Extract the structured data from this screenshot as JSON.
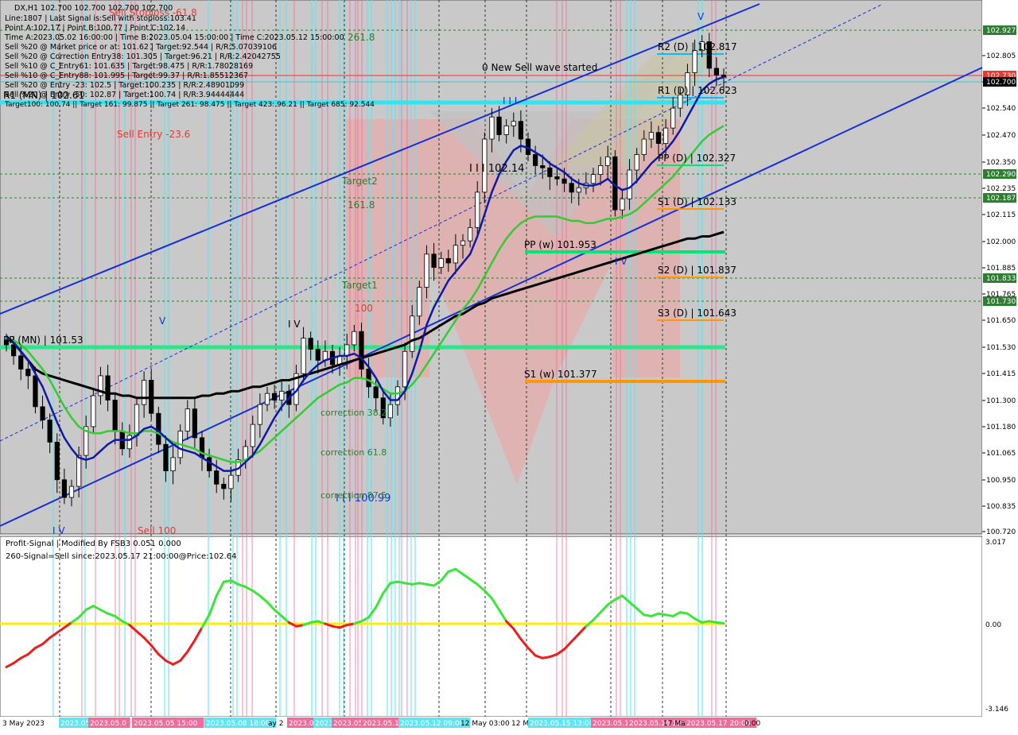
{
  "window": {
    "symbol_line": "DX,H1  102.700 102.700 102.700 102.700",
    "info_lines": [
      "Line:1807 | Last Signal is:Sell with stoploss:103.41",
      "Point A:102.17 | Point B:100.77 | Point C:102.14",
      "Time A:2023.05.02 16:00:00 | Time B:2023.05.04 15:00:00 | Time C:2023.05.12 15:00:00",
      "Sell %20 @ Market price or at: 101.62 | Target:92.544 | R/R:5.07039106",
      "Sell %20 @ Correction Entry38: 101.305 | Target:96.21 | R/R:2.42042755",
      "Sell %10 @ C_Entry61: 101.635 | Target:98.475 | R/R:1.78028169",
      "Sell %10 @ C_Entry88: 101.995 | Target:99.37 | R/R:1.85512367",
      "Sell %20 @ Entry -23: 102.5 | Target:100.235 | R/R:2.48901099",
      "Sell %20 @ Entry -50: 102.87 | Target:100.74 | R/R:3.94444444"
    ],
    "targets_line": "Target100: 100.74 || Target 161: 99.875 || Target 261: 98.475 || Target 423: 96.21 || Target 685: 92.544"
  },
  "annotations": {
    "sell_stoploss": "Sell Stoploss -61.8",
    "sell_entry": "Sell Entry -23.6",
    "sell_100": "Sell 100",
    "target_261": "261.8",
    "target2": "Target2",
    "target_161": "161.8",
    "target1": "Target1",
    "t100": "100",
    "new_wave": "0 New Sell wave started",
    "wave_label_c": "I I I 102.14",
    "wave_label_b": "I I I 100.99",
    "corr_382": "correction 38.2",
    "corr_618": "correction 61.8",
    "corr_875": "correction 87.5",
    "r1_mn": "R1 (MN) | 102.61",
    "pp_mn": "PP (MN) | 101.53",
    "roman_3": "I I I",
    "roman_4": "I V",
    "roman_iv2": "I V",
    "roman_v": "V",
    "roman_v2": "V",
    "roman_iv_top": "I V",
    "roman_v_bot": "I V"
  },
  "pivots": [
    {
      "label": "R2 (D) | 102.817",
      "color": "#00c0ff"
    },
    {
      "label": "R1 (D) | 102.623",
      "color": "#00c0ff"
    },
    {
      "label": "PP (D) | 102.327",
      "color": "#00e676"
    },
    {
      "label": "S1 (D) | 102.133",
      "color": "#ff9800"
    },
    {
      "label": "PP (w)    101.953",
      "color": "#00e676"
    },
    {
      "label": "S2 (D) | 101.837",
      "color": "#ff9800"
    },
    {
      "label": "S3 (D) | 101.643",
      "color": "#ff9800"
    },
    {
      "label": "S1 (w)    101.377",
      "color": "#ff9800"
    }
  ],
  "price_axis": {
    "ticks": [
      "102.805",
      "102.670",
      "102.540",
      "102.470",
      "102.350",
      "102.235",
      "102.115",
      "102.000",
      "101.885",
      "101.765",
      "101.650",
      "101.530",
      "101.415",
      "101.300",
      "101.180",
      "101.065",
      "100.950",
      "100.835",
      "100.720"
    ],
    "marks": [
      {
        "label": "102.927",
        "color": "#2e7d32"
      },
      {
        "label": "102.730",
        "color": "#e53935"
      },
      {
        "label": "102.700",
        "color": "#000000"
      },
      {
        "label": "102.290",
        "color": "#2e7d32"
      },
      {
        "label": "102.187",
        "color": "#2e7d32"
      },
      {
        "label": "101.833",
        "color": "#2e7d32"
      },
      {
        "label": "101.730",
        "color": "#2e7d32"
      }
    ]
  },
  "indicator": {
    "title": "Profit-Signal | Modified By FSB3 0.051 0.000",
    "signal_text": "260-Signal=Sell since:2023.05.17 21:00:00@Price:102.64",
    "axis_top": "3.017",
    "axis_zero": "0.00",
    "axis_bottom": "-3.146"
  },
  "time_axis": {
    "labels": [
      "3 May 2023",
      "2023.05.04",
      "2023.05.0",
      "2023.05.05 15:00",
      "2023.05.08 18:00",
      "ay 2",
      "2023.05.10",
      "2023.05",
      "2023.05.11",
      "2023.05.11 2",
      "2023.05.12 09:00",
      "12 May 03:00",
      "12 M",
      "2023.05.15 13:00",
      "2023.05.16",
      "2023.05.16 19:00",
      "17 Ma",
      "2023.05.17 20:00",
      "0:00"
    ]
  },
  "chart_data": {
    "type": "candlestick",
    "symbol": "DX",
    "timeframe": "H1",
    "ylim": [
      100.66,
      103.02
    ],
    "close_series": [
      101.49,
      101.44,
      101.38,
      101.35,
      101.21,
      101.15,
      101.05,
      100.88,
      100.8,
      100.85,
      100.99,
      101.12,
      101.26,
      101.35,
      101.24,
      101.1,
      101.02,
      101.08,
      101.22,
      101.33,
      101.18,
      101.04,
      100.92,
      100.98,
      101.1,
      101.2,
      101.07,
      100.98,
      100.92,
      100.86,
      100.84,
      100.9,
      100.97,
      101.03,
      101.13,
      101.22,
      101.27,
      101.24,
      101.28,
      101.22,
      101.36,
      101.52,
      101.47,
      101.42,
      101.46,
      101.4,
      101.44,
      101.49,
      101.55,
      101.38,
      101.3,
      101.25,
      101.16,
      101.22,
      101.3,
      101.46,
      101.62,
      101.75,
      101.9,
      101.84,
      101.88,
      101.86,
      101.94,
      101.96,
      102.02,
      102.18,
      102.42,
      102.52,
      102.44,
      102.48,
      102.5,
      102.42,
      102.35,
      102.3,
      102.29,
      102.25,
      102.24,
      102.22,
      102.18,
      102.2,
      102.22,
      102.26,
      102.3,
      102.34,
      102.1,
      102.15,
      102.28,
      102.35,
      102.42,
      102.45,
      102.4,
      102.47,
      102.56,
      102.62,
      102.72,
      102.82,
      102.86,
      102.74,
      102.71,
      102.7
    ],
    "ma_blue_series": [
      101.53,
      101.5,
      101.46,
      101.42,
      101.36,
      101.3,
      101.22,
      101.14,
      101.07,
      101.02,
      100.98,
      100.97,
      100.98,
      101.01,
      101.04,
      101.06,
      101.06,
      101.06,
      101.08,
      101.11,
      101.12,
      101.1,
      101.07,
      101.04,
      101.02,
      101.01,
      101.0,
      100.98,
      100.96,
      100.94,
      100.92,
      100.92,
      100.93,
      100.96,
      100.99,
      101.04,
      101.1,
      101.16,
      101.21,
      101.25,
      101.28,
      101.33,
      101.37,
      101.4,
      101.42,
      101.43,
      101.44,
      101.44,
      101.45,
      101.43,
      101.39,
      101.34,
      101.28,
      101.24,
      101.24,
      101.28,
      101.36,
      101.46,
      101.58,
      101.66,
      101.72,
      101.78,
      101.82,
      101.86,
      101.9,
      101.98,
      102.08,
      102.18,
      102.26,
      102.32,
      102.37,
      102.39,
      102.38,
      102.36,
      102.34,
      102.31,
      102.29,
      102.27,
      102.24,
      102.22,
      102.21,
      102.21,
      102.22,
      102.24,
      102.21,
      102.19,
      102.2,
      102.23,
      102.27,
      102.31,
      102.34,
      102.37,
      102.41,
      102.46,
      102.52,
      102.58,
      102.64,
      102.67,
      102.69,
      102.7
    ],
    "ma_green_series": [
      101.52,
      101.51,
      101.49,
      101.46,
      101.42,
      101.38,
      101.33,
      101.27,
      101.21,
      101.16,
      101.12,
      101.1,
      101.09,
      101.09,
      101.1,
      101.1,
      101.1,
      101.09,
      101.09,
      101.1,
      101.1,
      101.09,
      101.07,
      101.05,
      101.04,
      101.03,
      101.02,
      101.0,
      100.99,
      100.98,
      100.97,
      100.96,
      100.96,
      100.97,
      100.99,
      101.01,
      101.04,
      101.07,
      101.1,
      101.13,
      101.16,
      101.19,
      101.22,
      101.25,
      101.27,
      101.29,
      101.31,
      101.32,
      101.34,
      101.34,
      101.33,
      101.31,
      101.29,
      101.27,
      101.27,
      101.28,
      101.31,
      101.35,
      101.4,
      101.45,
      101.5,
      101.55,
      101.6,
      101.65,
      101.69,
      101.74,
      101.8,
      101.86,
      101.92,
      101.97,
      102.01,
      102.04,
      102.06,
      102.07,
      102.07,
      102.07,
      102.07,
      102.06,
      102.05,
      102.05,
      102.04,
      102.04,
      102.05,
      102.06,
      102.06,
      102.07,
      102.08,
      102.1,
      102.13,
      102.16,
      102.19,
      102.22,
      102.25,
      102.29,
      102.33,
      102.37,
      102.41,
      102.44,
      102.46,
      102.48
    ],
    "ma_black_series": [
      101.52,
      101.5,
      101.46,
      101.42,
      101.38,
      101.36,
      101.35,
      101.34,
      101.33,
      101.32,
      101.31,
      101.3,
      101.29,
      101.28,
      101.27,
      101.27,
      101.26,
      101.26,
      101.25,
      101.25,
      101.25,
      101.25,
      101.25,
      101.25,
      101.25,
      101.25,
      101.25,
      101.26,
      101.26,
      101.27,
      101.27,
      101.28,
      101.28,
      101.29,
      101.3,
      101.3,
      101.31,
      101.32,
      101.33,
      101.33,
      101.34,
      101.35,
      101.36,
      101.37,
      101.38,
      101.39,
      101.4,
      101.41,
      101.42,
      101.43,
      101.44,
      101.45,
      101.46,
      101.47,
      101.48,
      101.49,
      101.51,
      101.52,
      101.54,
      101.56,
      101.58,
      101.6,
      101.62,
      101.63,
      101.65,
      101.67,
      101.68,
      101.7,
      101.71,
      101.72,
      101.73,
      101.74,
      101.75,
      101.76,
      101.77,
      101.78,
      101.79,
      101.8,
      101.81,
      101.82,
      101.83,
      101.84,
      101.85,
      101.86,
      101.87,
      101.88,
      101.89,
      101.9,
      101.91,
      101.92,
      101.93,
      101.94,
      101.95,
      101.96,
      101.97,
      101.97,
      101.98,
      101.98,
      101.99,
      102.0
    ],
    "signal_series": [
      -1.7,
      -1.55,
      -1.35,
      -1.2,
      -0.95,
      -0.8,
      -0.55,
      -0.35,
      -0.15,
      0.05,
      0.25,
      0.55,
      0.7,
      0.55,
      0.4,
      0.3,
      0.1,
      -0.05,
      -0.3,
      -0.55,
      -0.85,
      -1.2,
      -1.45,
      -1.6,
      -1.45,
      -1.1,
      -0.65,
      -0.15,
      0.35,
      1.1,
      1.65,
      1.7,
      1.55,
      1.45,
      1.3,
      1.1,
      0.85,
      0.55,
      0.3,
      0.05,
      -0.1,
      -0.05,
      0.05,
      0.1,
      0.0,
      -0.1,
      -0.15,
      -0.05,
      0.0,
      0.1,
      0.25,
      0.65,
      1.2,
      1.6,
      1.65,
      1.6,
      1.55,
      1.6,
      1.55,
      1.5,
      1.7,
      2.05,
      2.15,
      1.95,
      1.75,
      1.55,
      1.3,
      1.0,
      0.55,
      0.1,
      -0.2,
      -0.6,
      -0.95,
      -1.25,
      -1.35,
      -1.3,
      -1.2,
      -1.0,
      -0.7,
      -0.4,
      -0.1,
      0.15,
      0.45,
      0.75,
      0.95,
      1.1,
      0.85,
      0.6,
      0.35,
      0.3,
      0.4,
      0.35,
      0.3,
      0.45,
      0.4,
      0.2,
      0.05,
      0.1,
      0.05,
      0.02
    ]
  }
}
